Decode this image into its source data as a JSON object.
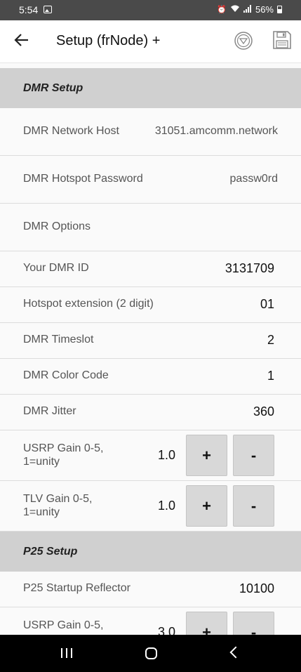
{
  "status_bar": {
    "time": "5:54",
    "battery": "56%",
    "icons": [
      "gallery-icon",
      "alarm-icon",
      "wifi-icon",
      "signal-icon",
      "battery-icon"
    ]
  },
  "app_bar": {
    "title": "Setup (frNode) +",
    "icons": [
      "back-arrow-icon",
      "dropdown-circle-icon",
      "save-icon"
    ]
  },
  "dmr_setup": {
    "header": "DMR Setup",
    "network_host_label": "DMR Network Host",
    "network_host_value": "31051.amcomm.network",
    "password_label": "DMR Hotspot Password",
    "password_value": "passw0rd",
    "options_label": "DMR Options",
    "dmr_id_label": "Your DMR ID",
    "dmr_id_value": "3131709",
    "extension_label": "Hotspot extension (2 digit)",
    "extension_value": "01",
    "timeslot_label": "DMR Timeslot",
    "timeslot_value": "2",
    "color_code_label": "DMR Color Code",
    "color_code_value": "1",
    "jitter_label": "DMR Jitter",
    "jitter_value": "360",
    "usrp_gain_label": "USRP Gain 0-5, 1=unity",
    "usrp_gain_value": "1.0",
    "tlv_gain_label": "TLV Gain 0-5, 1=unity",
    "tlv_gain_value": "1.0"
  },
  "p25_setup": {
    "header": "P25 Setup",
    "reflector_label": "P25 Startup Reflector",
    "reflector_value": "10100",
    "usrp_gain_label": "USRP Gain 0-5,",
    "usrp_gain_value": "3.0"
  },
  "buttons": {
    "plus": "+",
    "minus": "-"
  },
  "colors": {
    "status_bar": "#4a4a4a",
    "section_header": "#d0d0d0",
    "button": "#d8d8d8",
    "nav_bar": "#000000"
  }
}
